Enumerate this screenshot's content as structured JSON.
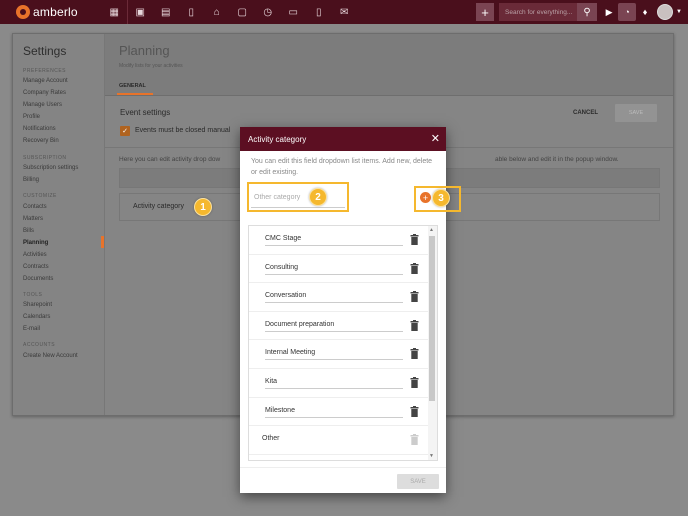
{
  "topbar": {
    "logo_text": "amberlo",
    "search_placeholder": "Search for everything...",
    "add_label": "+",
    "nav_icons": [
      "dashboard-icon",
      "contacts-icon",
      "matters-icon",
      "documents-icon",
      "bank-icon",
      "calendar-icon",
      "activities-icon",
      "folder-icon",
      "bills-icon",
      "mail-icon"
    ]
  },
  "sidebar": {
    "title": "Settings",
    "sections": [
      {
        "label": "PREFERENCES",
        "items": [
          "Manage Account",
          "Company Rates",
          "Manage Users",
          "Profile",
          "Notifications",
          "Recovery Bin"
        ]
      },
      {
        "label": "SUBSCRIPTION",
        "items": [
          "Subscription settings",
          "Billing"
        ]
      },
      {
        "label": "CUSTOMIZE",
        "items": [
          "Contacts",
          "Matters",
          "Bills",
          "Planning",
          "Activities",
          "Contracts",
          "Documents"
        ]
      },
      {
        "label": "TOOLS",
        "items": [
          "Sharepoint",
          "Calendars",
          "E-mail"
        ]
      },
      {
        "label": "ACCOUNTS",
        "items": [
          "Create New Account"
        ]
      }
    ],
    "active": "Planning"
  },
  "content": {
    "title": "Planning",
    "subtitle": "Modify lists for your activities",
    "tab": "GENERAL",
    "event_settings": "Event settings",
    "cancel": "CANCEL",
    "save": "SAVE",
    "checkbox_label": "Events must be closed manual",
    "help_left": "Here you can edit activity drop dow",
    "help_right": "able below and edit it in the popup window.",
    "row_label": "Activity category"
  },
  "modal": {
    "title": "Activity category",
    "close": "✕",
    "description": "You can edit this field dropdown list items. Add new, delete or edit existing.",
    "input_placeholder": "Other category",
    "items": [
      "CMC Stage",
      "Consulting",
      "Conversation",
      "Document preparation",
      "Internal Meeting",
      "Kita",
      "Milestone",
      "Other"
    ],
    "save": "SAVE"
  },
  "markers": [
    "1",
    "2",
    "3"
  ],
  "colors": {
    "topbar": "#4a0f1c",
    "modal_header": "#5c0f22",
    "accent": "#e8732a",
    "marker": "#f5b82e"
  }
}
